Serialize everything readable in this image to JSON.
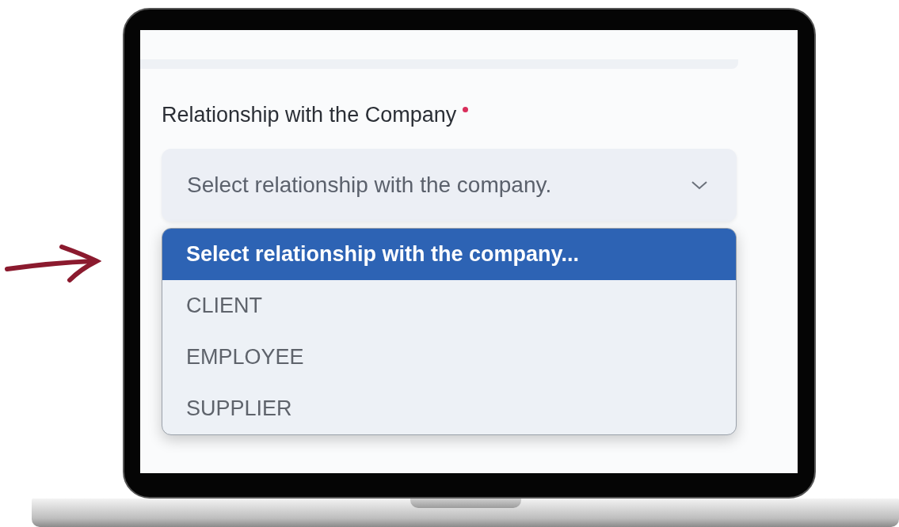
{
  "field": {
    "label": "Relationship with the Company",
    "required": true,
    "selected_text": "Select relationship with the company."
  },
  "options": [
    {
      "label": "Select relationship with the company...",
      "selected": true
    },
    {
      "label": "CLIENT",
      "selected": false
    },
    {
      "label": "EMPLOYEE",
      "selected": false
    },
    {
      "label": "SUPPLIER",
      "selected": false
    }
  ]
}
